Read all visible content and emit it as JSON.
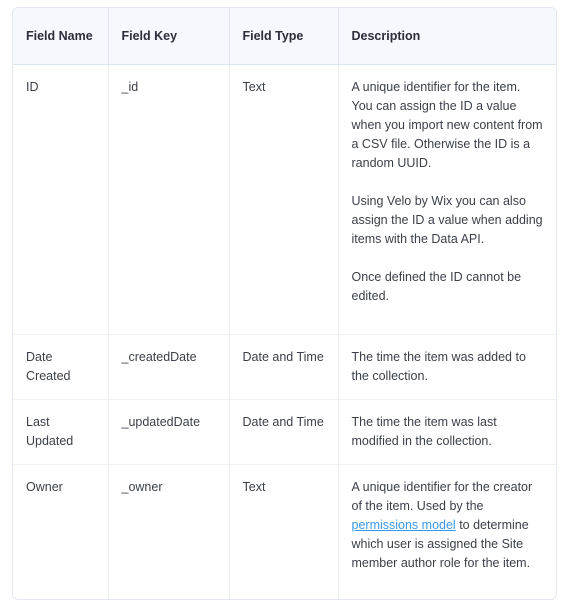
{
  "table": {
    "columns": [
      {
        "key": "field_name",
        "label": "Field Name"
      },
      {
        "key": "field_key",
        "label": "Field Key"
      },
      {
        "key": "field_type",
        "label": "Field Type"
      },
      {
        "key": "description",
        "label": "Description"
      }
    ],
    "link_color": "#3899ec",
    "header_background": "#f5f8fd",
    "border_color": "#dde5f1",
    "rows": [
      {
        "field_name": "ID",
        "field_key": "_id",
        "field_type": "Text",
        "description_paragraphs": [
          "A unique identifier for the item. You can assign the ID a value when you import new content from a CSV file. Otherwise the ID is a random UUID.",
          "Using Velo by Wix you can also assign the ID a value when adding items with the Data API.",
          "Once defined the ID cannot be edited."
        ]
      },
      {
        "field_name": "Date Created",
        "field_key": "_createdDate",
        "field_type": "Date and Time",
        "description_paragraphs": [
          "The time the item was added to the collection."
        ]
      },
      {
        "field_name": "Last Updated",
        "field_key": "_updatedDate",
        "field_type": "Date and Time",
        "description_paragraphs": [
          "The time the item was last modified in the collection."
        ]
      },
      {
        "field_name": "Owner",
        "field_key": "_owner",
        "field_type": "Text",
        "description_rich": {
          "before": "A unique identifier for the creator of the item. Used by the ",
          "link_text": "permissions model",
          "after": " to determine which user is assigned the Site member author role for the item."
        }
      }
    ]
  }
}
